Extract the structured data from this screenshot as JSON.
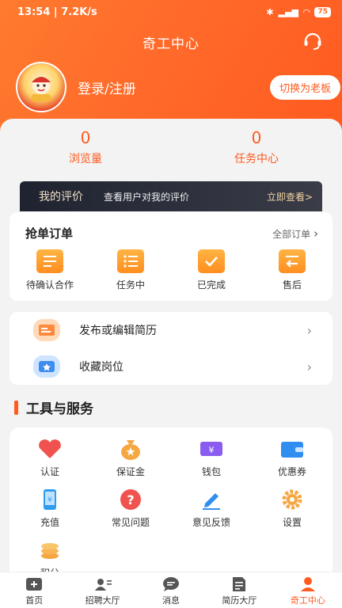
{
  "status_bar": {
    "time": "13:54",
    "speed": "7.2K/s",
    "battery": "75"
  },
  "header": {
    "title": "奇工中心"
  },
  "profile": {
    "login_label": "登录/注册",
    "switch_label": "切换为老板"
  },
  "stats": [
    {
      "value": "0",
      "label": "浏览量"
    },
    {
      "value": "0",
      "label": "任务中心"
    }
  ],
  "review": {
    "title": "我的评价",
    "desc": "查看用户对我的评价",
    "link": "立即查看>"
  },
  "orders": {
    "title": "抢单订单",
    "all_label": "全部订单",
    "items": [
      {
        "label": "待确认合作",
        "icon": "pending-icon"
      },
      {
        "label": "任务中",
        "icon": "task-list-icon"
      },
      {
        "label": "已完成",
        "icon": "check-icon"
      },
      {
        "label": "售后",
        "icon": "return-icon"
      }
    ]
  },
  "resume_menu": [
    {
      "label": "发布或编辑简历",
      "icon": "resume-icon"
    },
    {
      "label": "收藏岗位",
      "icon": "star-icon"
    }
  ],
  "tools": {
    "title": "工具与服务",
    "items": [
      {
        "label": "认证",
        "icon": "handshake-icon"
      },
      {
        "label": "保证金",
        "icon": "money-bag-icon"
      },
      {
        "label": "钱包",
        "icon": "ticket-icon"
      },
      {
        "label": "优惠券",
        "icon": "wallet-icon"
      },
      {
        "label": "充值",
        "icon": "phone-icon"
      },
      {
        "label": "常见问题",
        "icon": "question-icon"
      },
      {
        "label": "意见反馈",
        "icon": "pen-icon"
      },
      {
        "label": "设置",
        "icon": "gear-icon"
      },
      {
        "label": "积分",
        "icon": "coins-icon"
      }
    ]
  },
  "bottom_nav": [
    {
      "label": "首页",
      "icon": "home-icon"
    },
    {
      "label": "招聘大厅",
      "icon": "recruit-icon"
    },
    {
      "label": "消息",
      "icon": "message-icon"
    },
    {
      "label": "简历大厅",
      "icon": "resume-hall-icon"
    },
    {
      "label": "奇工中心",
      "icon": "profile-icon",
      "active": true
    }
  ],
  "colors": {
    "accent": "#ff5a1f",
    "review_bg": "#1f2330"
  }
}
